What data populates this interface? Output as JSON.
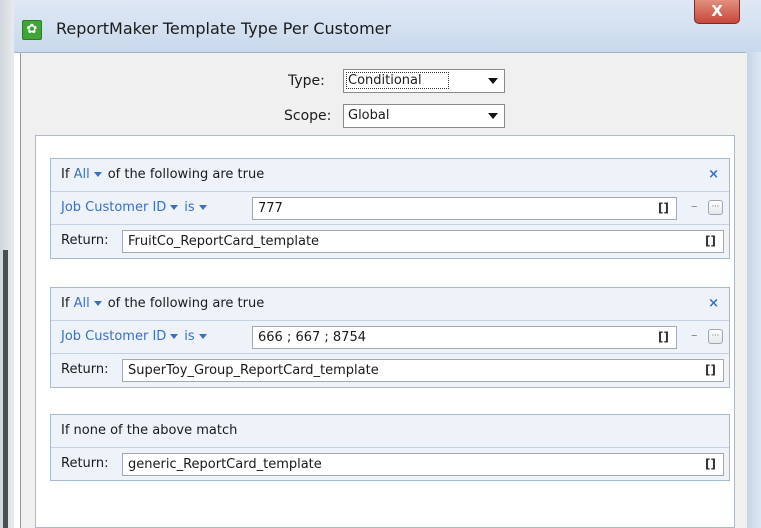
{
  "window": {
    "title": "ReportMaker Template Type Per Customer",
    "app_icon": "gear-icon",
    "close_label": "X"
  },
  "form": {
    "type_label": "Type:",
    "type_value": "Conditional",
    "scope_label": "Scope:",
    "scope_value": "Global"
  },
  "rules": [
    {
      "if_prefix": "If",
      "quantifier": "All",
      "if_suffix": "of the following are true",
      "remove_label": "×",
      "condition": {
        "field": "Job Customer ID",
        "operator": "is",
        "value": "777",
        "bracket_label": "[]",
        "minus_label": "–",
        "more_label": "···"
      },
      "return_label": "Return:",
      "return_value": "FruitCo_ReportCard_template",
      "return_bracket": "[]"
    },
    {
      "if_prefix": "If",
      "quantifier": "All",
      "if_suffix": "of the following are true",
      "remove_label": "×",
      "condition": {
        "field": "Job Customer ID",
        "operator": "is",
        "value": "666 ; 667 ; 8754",
        "bracket_label": "[]",
        "minus_label": "–",
        "more_label": "···"
      },
      "return_label": "Return:",
      "return_value": "SuperToy_Group_ReportCard_template",
      "return_bracket": "[]"
    }
  ],
  "default_rule": {
    "header": "If none of the above match",
    "return_label": "Return:",
    "return_value": "generic_ReportCard_template",
    "return_bracket": "[]"
  },
  "colors": {
    "accent_blue": "#3a6fc4",
    "block_bg": "#eef3f9",
    "close_red": "#c8463a"
  }
}
